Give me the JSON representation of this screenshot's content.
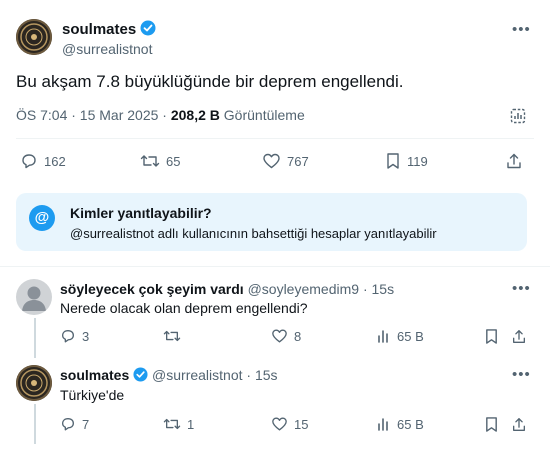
{
  "main_tweet": {
    "display_name": "soulmates",
    "handle": "@surrealistnot",
    "text": "Bu akşam 7.8 büyüklüğünde bir deprem engellendi.",
    "time": "ÖS 7:04 · 15 Mar 2025 ·",
    "views_count": "208,2 B",
    "views_label": "Görüntüleme",
    "stats": {
      "replies": "162",
      "reposts": "65",
      "likes": "767",
      "bookmarks": "119"
    }
  },
  "reply_notice": {
    "title": "Kimler yanıtlayabilir?",
    "text": "@surrealistnot adlı kullanıcının bahsettiği hesaplar yanıtlayabilir"
  },
  "replies": [
    {
      "display_name": "söyleyecek çok şeyim vardı",
      "handle": "@soyleyemedim9",
      "time": "· 15s",
      "text": "Nerede olacak olan deprem engellendi?",
      "stats": {
        "replies": "3",
        "reposts": "",
        "likes": "8",
        "views": "65 B"
      }
    },
    {
      "display_name": "soulmates",
      "handle": "@surrealistnot",
      "time": "· 15s",
      "text": "Türkiye'de",
      "stats": {
        "replies": "7",
        "reposts": "1",
        "likes": "15",
        "views": "65 B"
      }
    }
  ],
  "colors": {
    "accent": "#1d9bf0",
    "text": "#0f1419",
    "muted": "#536471",
    "notice_bg": "#e8f5fd"
  },
  "icons": [
    "avatar-logo",
    "verified-badge",
    "more-icon",
    "reply-icon",
    "repost-icon",
    "like-icon",
    "bookmark-icon",
    "share-icon",
    "analytics-icon",
    "views-icon",
    "at-icon"
  ]
}
